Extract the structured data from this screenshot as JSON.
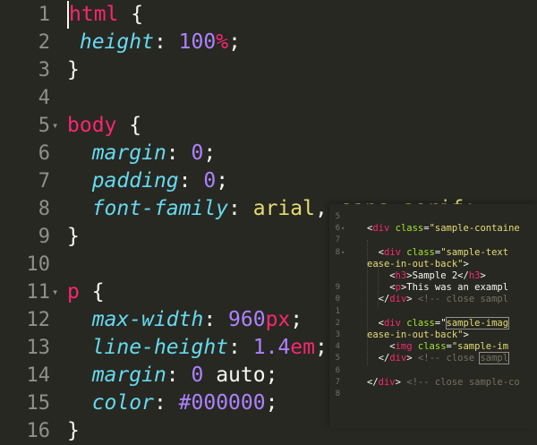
{
  "editor": {
    "lines": [
      {
        "num": "1",
        "fold": false,
        "cursor": true,
        "tokens": [
          {
            "t": "html",
            "c": "sel"
          },
          {
            "t": " {",
            "c": "punc"
          }
        ]
      },
      {
        "num": "2",
        "fold": false,
        "tokens": [
          {
            "t": " ",
            "c": "punc"
          },
          {
            "t": "height",
            "c": "prop"
          },
          {
            "t": ": ",
            "c": "punc"
          },
          {
            "t": "100",
            "c": "num"
          },
          {
            "t": "%",
            "c": "unit"
          },
          {
            "t": ";",
            "c": "punc"
          }
        ]
      },
      {
        "num": "3",
        "fold": false,
        "tokens": [
          {
            "t": "}",
            "c": "punc"
          }
        ]
      },
      {
        "num": "4",
        "fold": false,
        "tokens": []
      },
      {
        "num": "5",
        "fold": true,
        "tokens": [
          {
            "t": "body",
            "c": "sel"
          },
          {
            "t": " {",
            "c": "punc"
          }
        ]
      },
      {
        "num": "6",
        "fold": false,
        "tokens": [
          {
            "t": "  ",
            "c": "punc"
          },
          {
            "t": "margin",
            "c": "prop"
          },
          {
            "t": ": ",
            "c": "punc"
          },
          {
            "t": "0",
            "c": "num"
          },
          {
            "t": ";",
            "c": "punc"
          }
        ]
      },
      {
        "num": "7",
        "fold": false,
        "tokens": [
          {
            "t": "  ",
            "c": "punc"
          },
          {
            "t": "padding",
            "c": "prop"
          },
          {
            "t": ": ",
            "c": "punc"
          },
          {
            "t": "0",
            "c": "num"
          },
          {
            "t": ";",
            "c": "punc"
          }
        ]
      },
      {
        "num": "8",
        "fold": false,
        "tokens": [
          {
            "t": "  ",
            "c": "punc"
          },
          {
            "t": "font-family",
            "c": "prop"
          },
          {
            "t": ": ",
            "c": "punc"
          },
          {
            "t": "arial",
            "c": "str"
          },
          {
            "t": ", ",
            "c": "punc"
          },
          {
            "t": "sans-serif",
            "c": "str"
          },
          {
            "t": ";",
            "c": "punc"
          }
        ]
      },
      {
        "num": "9",
        "fold": false,
        "tokens": [
          {
            "t": "}",
            "c": "punc"
          }
        ]
      },
      {
        "num": "10",
        "fold": false,
        "tokens": []
      },
      {
        "num": "11",
        "fold": true,
        "tokens": [
          {
            "t": "p",
            "c": "sel"
          },
          {
            "t": " {",
            "c": "punc"
          }
        ]
      },
      {
        "num": "12",
        "fold": false,
        "tokens": [
          {
            "t": "  ",
            "c": "punc"
          },
          {
            "t": "max-width",
            "c": "prop"
          },
          {
            "t": ": ",
            "c": "punc"
          },
          {
            "t": "960",
            "c": "num"
          },
          {
            "t": "px",
            "c": "unit"
          },
          {
            "t": ";",
            "c": "punc"
          }
        ]
      },
      {
        "num": "13",
        "fold": false,
        "tokens": [
          {
            "t": "  ",
            "c": "punc"
          },
          {
            "t": "line-height",
            "c": "prop"
          },
          {
            "t": ": ",
            "c": "punc"
          },
          {
            "t": "1.4",
            "c": "num"
          },
          {
            "t": "em",
            "c": "unit"
          },
          {
            "t": ";",
            "c": "punc"
          }
        ]
      },
      {
        "num": "14",
        "fold": false,
        "tokens": [
          {
            "t": "  ",
            "c": "punc"
          },
          {
            "t": "margin",
            "c": "prop"
          },
          {
            "t": ": ",
            "c": "punc"
          },
          {
            "t": "0",
            "c": "num"
          },
          {
            "t": " auto;",
            "c": "punc"
          }
        ]
      },
      {
        "num": "15",
        "fold": false,
        "tokens": [
          {
            "t": "  ",
            "c": "punc"
          },
          {
            "t": "color",
            "c": "prop"
          },
          {
            "t": ": ",
            "c": "punc"
          },
          {
            "t": "#000000",
            "c": "num"
          },
          {
            "t": ";",
            "c": "punc"
          }
        ]
      },
      {
        "num": "16",
        "fold": false,
        "tokens": [
          {
            "t": "}",
            "c": "punc"
          }
        ]
      }
    ]
  },
  "overlay": {
    "gutter": [
      "5",
      "6",
      "7",
      "8",
      "",
      "",
      "9",
      "0",
      "1",
      "2",
      "3",
      "4",
      "5",
      "6",
      "7",
      "8"
    ],
    "lines": [
      {
        "tokens": []
      },
      {
        "tokens": [
          {
            "t": "<",
            "c": "punc"
          },
          {
            "t": "div",
            "c": "tag"
          },
          {
            "t": " ",
            "c": "punc"
          },
          {
            "t": "class",
            "c": "attr"
          },
          {
            "t": "=",
            "c": "punc"
          },
          {
            "t": "\"sample-containe",
            "c": "ostr"
          }
        ]
      },
      {
        "tokens": []
      },
      {
        "tokens": [
          {
            "t": "  <",
            "c": "punc"
          },
          {
            "t": "div",
            "c": "tag"
          },
          {
            "t": " ",
            "c": "punc"
          },
          {
            "t": "class",
            "c": "attr"
          },
          {
            "t": "=",
            "c": "punc"
          },
          {
            "t": "\"sample-text",
            "c": "ostr"
          }
        ]
      },
      {
        "tokens": [
          {
            "t": "ease-in-out-back\"",
            "c": "ostr"
          },
          {
            "t": ">",
            "c": "punc"
          }
        ]
      },
      {
        "tokens": [
          {
            "t": "    <",
            "c": "punc"
          },
          {
            "t": "h3",
            "c": "tag"
          },
          {
            "t": ">Sample 2</",
            "c": "punc"
          },
          {
            "t": "h3",
            "c": "tag"
          },
          {
            "t": ">",
            "c": "punc"
          }
        ]
      },
      {
        "tokens": [
          {
            "t": "    <",
            "c": "punc"
          },
          {
            "t": "p",
            "c": "tag"
          },
          {
            "t": ">This was an exampl",
            "c": "punc"
          }
        ]
      },
      {
        "tokens": [
          {
            "t": "  </",
            "c": "punc"
          },
          {
            "t": "div",
            "c": "tag"
          },
          {
            "t": "> ",
            "c": "punc"
          },
          {
            "t": "<!-- close sampl",
            "c": "cmt"
          }
        ]
      },
      {
        "tokens": []
      },
      {
        "tokens": [
          {
            "t": "  <",
            "c": "punc"
          },
          {
            "t": "div",
            "c": "tag"
          },
          {
            "t": " ",
            "c": "punc"
          },
          {
            "t": "class",
            "c": "attr"
          },
          {
            "t": "=\"",
            "c": "punc"
          },
          {
            "t": "sample-imag",
            "c": "ostr",
            "box": true
          }
        ]
      },
      {
        "tokens": [
          {
            "t": "ease-in-out-back\"",
            "c": "ostr"
          },
          {
            "t": ">",
            "c": "punc"
          }
        ]
      },
      {
        "tokens": [
          {
            "t": "    <",
            "c": "punc"
          },
          {
            "t": "img",
            "c": "tag"
          },
          {
            "t": " ",
            "c": "punc"
          },
          {
            "t": "class",
            "c": "attr"
          },
          {
            "t": "=",
            "c": "punc"
          },
          {
            "t": "\"sample-im",
            "c": "ostr"
          }
        ]
      },
      {
        "tokens": [
          {
            "t": "  </",
            "c": "punc"
          },
          {
            "t": "div",
            "c": "tag"
          },
          {
            "t": "> ",
            "c": "punc"
          },
          {
            "t": "<!-- close ",
            "c": "cmt"
          },
          {
            "t": "sampl",
            "c": "cmt",
            "box": true
          }
        ]
      },
      {
        "tokens": []
      },
      {
        "tokens": [
          {
            "t": "</",
            "c": "punc"
          },
          {
            "t": "div",
            "c": "tag"
          },
          {
            "t": "> ",
            "c": "punc"
          },
          {
            "t": "<!-- close sample-co",
            "c": "cmt"
          }
        ]
      },
      {
        "tokens": []
      }
    ]
  }
}
